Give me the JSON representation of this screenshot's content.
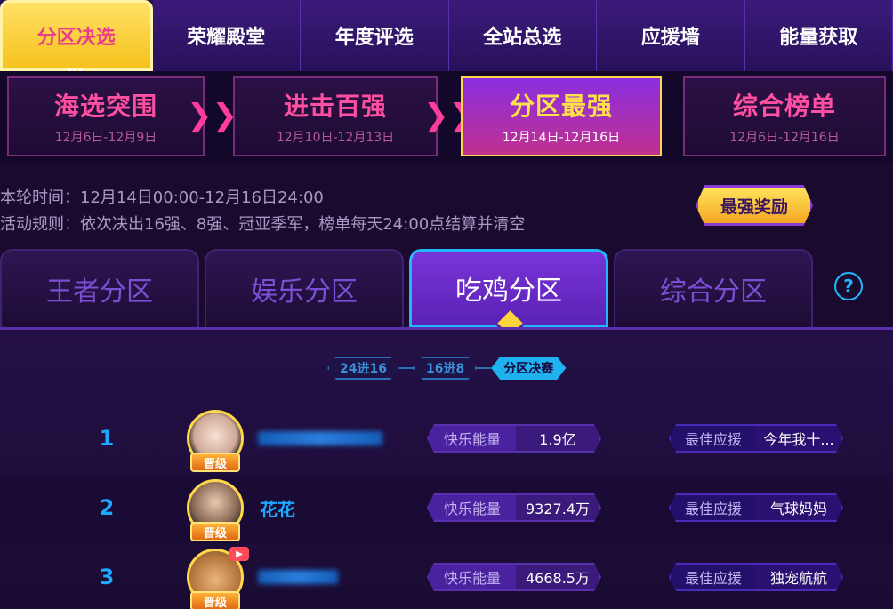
{
  "top_tabs": [
    "分区决选",
    "荣耀殿堂",
    "年度评选",
    "全站总选",
    "应援墙",
    "能量获取"
  ],
  "phases": [
    {
      "title": "海选突围",
      "date": "12月6日-12月9日"
    },
    {
      "title": "进击百强",
      "date": "12月10日-12月13日"
    },
    {
      "title": "分区最强",
      "date": "12月14日-12月16日"
    },
    {
      "title": "综合榜单",
      "date": "12月6日-12月16日"
    }
  ],
  "info": {
    "time": "本轮时间：12月14日00:00-12月16日24:00",
    "rules": "活动规则：依次决出16强、8强、冠亚季军，榜单每天24:00点结算并清空",
    "reward_button": "最强奖励"
  },
  "zone_tabs": [
    "王者分区",
    "娱乐分区",
    "吃鸡分区",
    "综合分区"
  ],
  "help_glyph": "?",
  "stages": [
    "24进16",
    "16进8",
    "分区决赛"
  ],
  "rows": [
    {
      "rank": "1",
      "name": "",
      "badge": "晋级",
      "energy_label": "快乐能量",
      "energy_value": "1.9亿",
      "support_label": "最佳应援",
      "support_value": "今年我十..."
    },
    {
      "rank": "2",
      "name": "花花",
      "badge": "晋级",
      "energy_label": "快乐能量",
      "energy_value": "9327.4万",
      "support_label": "最佳应援",
      "support_value": "气球妈妈"
    },
    {
      "rank": "3",
      "name": "",
      "badge": "晋级",
      "energy_label": "快乐能量",
      "energy_value": "4668.5万",
      "support_label": "最佳应援",
      "support_value": "独宠航航"
    }
  ],
  "colors": {
    "accent_blue": "#1fa8ff",
    "pink": "#ff4fa0",
    "gold": "#ffd84a",
    "purple": "#7a34d8"
  }
}
